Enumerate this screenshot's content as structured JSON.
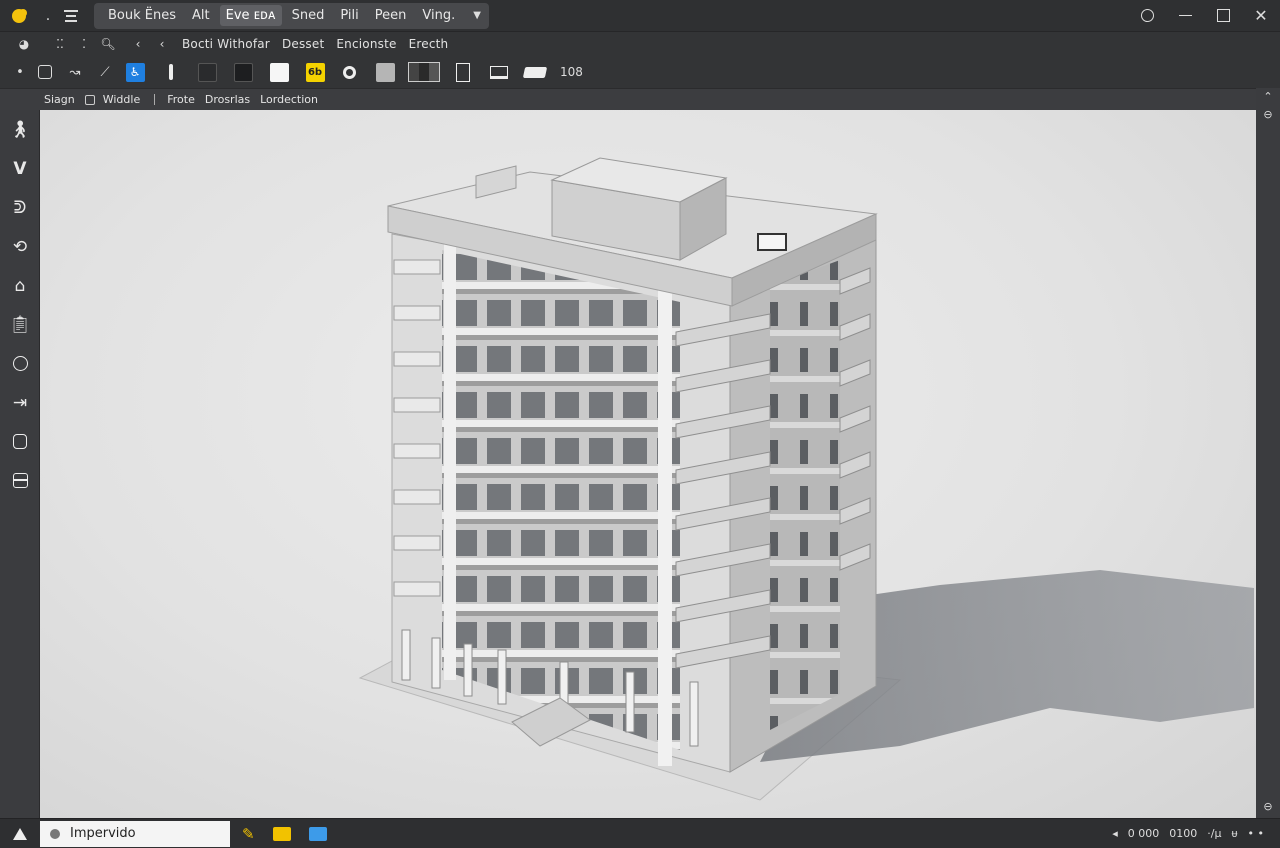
{
  "titlebar": {
    "menu": [
      {
        "label": "Bouk Ënes",
        "active": false
      },
      {
        "label": "Alt",
        "active": false
      },
      {
        "label": "Eve ᴇᴅᴀ",
        "active": true
      },
      {
        "label": "Sned",
        "active": false
      },
      {
        "label": "Pili",
        "active": false
      },
      {
        "label": "Peen",
        "active": false
      },
      {
        "label": "Ving.",
        "active": false
      }
    ],
    "glyph_period": "."
  },
  "toolbar1": {
    "labels": [
      "Bocti Withofar",
      "Desset",
      "Encionste",
      "Erecth"
    ]
  },
  "toolbar2": {
    "tag_label": "6b",
    "zoom": "108"
  },
  "options": {
    "items": [
      "Siagn",
      "Widdle",
      "Frote",
      "Drosrlas",
      "Lordection"
    ]
  },
  "status": {
    "input_value": "Impervido",
    "coords": "0 000",
    "coords2": "0100",
    "units": "·/µ",
    "extra": "ᵾ"
  },
  "colors": {
    "accent_yellow": "#f4c20d",
    "accent_blue": "#1f7fe0",
    "status_yellow": "#f2c200",
    "status_blue": "#3d9be9"
  }
}
